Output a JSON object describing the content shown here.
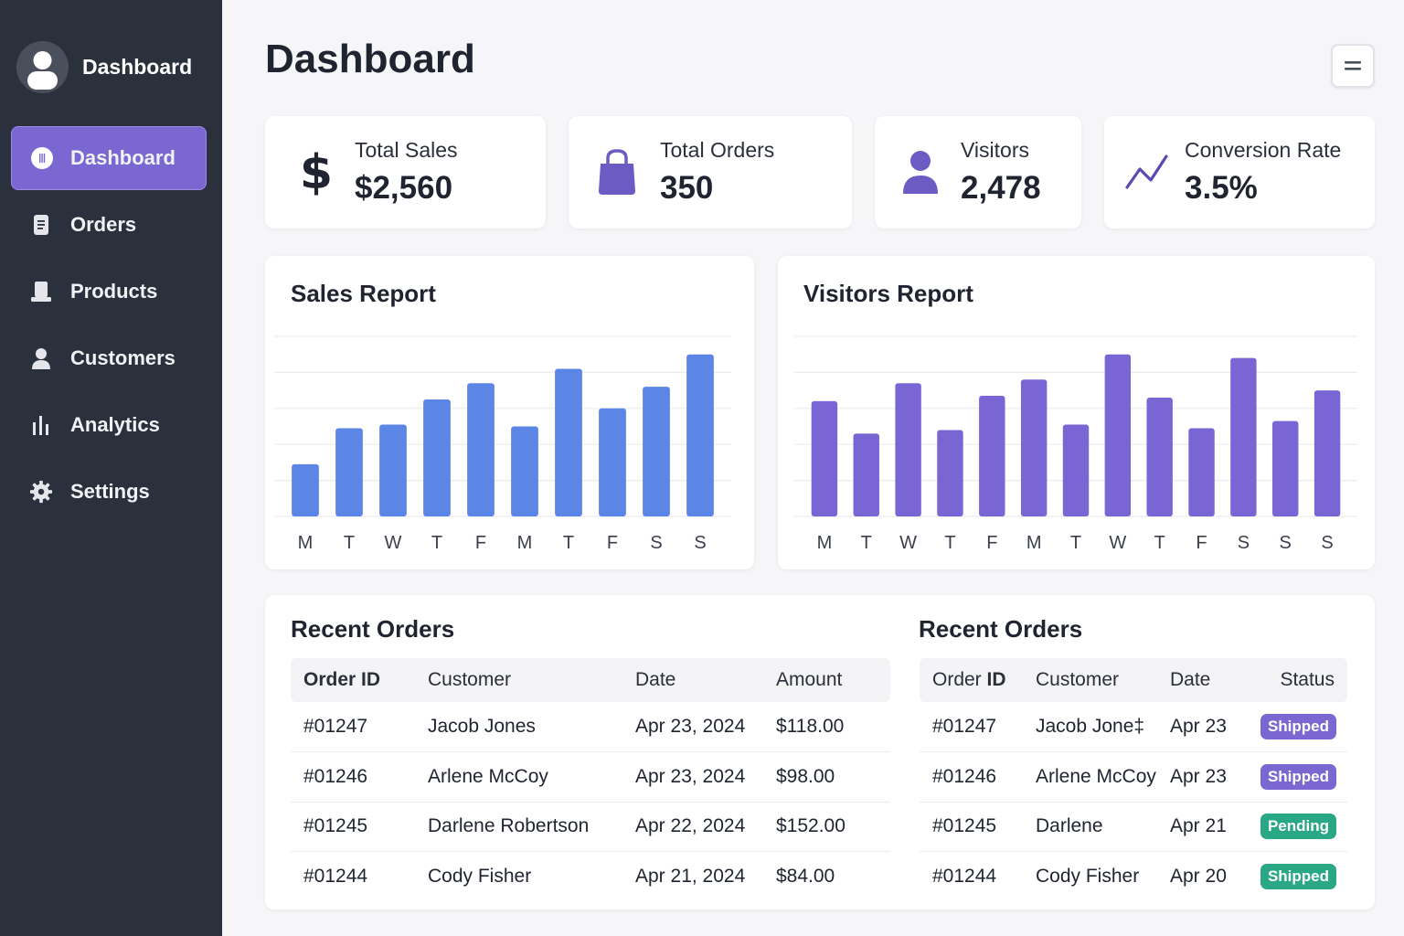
{
  "sidebar": {
    "brand": "Dashboard",
    "items": [
      {
        "label": "Dashboard",
        "icon": "dashboard-icon",
        "active": true
      },
      {
        "label": "Orders",
        "icon": "document-icon"
      },
      {
        "label": "Products",
        "icon": "box-icon"
      },
      {
        "label": "Customers",
        "icon": "user-icon"
      },
      {
        "label": "Analytics",
        "icon": "bar-chart-icon"
      },
      {
        "label": "Settings",
        "icon": "gear-icon"
      }
    ]
  },
  "header": {
    "title": "Dashboard",
    "menu_icon": "menu-icon"
  },
  "stats": [
    {
      "label": "Total Sales",
      "value": "$2,560",
      "icon": "dollar-icon"
    },
    {
      "label": "Total Orders",
      "value": "350",
      "icon": "shopping-bag-icon"
    },
    {
      "label": "Visitors",
      "value": "2,478",
      "icon": "user-icon"
    },
    {
      "label": "Conversion Rate",
      "value": "3.5%",
      "icon": "trend-line-icon"
    }
  ],
  "colors": {
    "sidebar_bg": "#2a313c",
    "accent": "#7a67d1",
    "sales_bar": "#5b86e5",
    "visitors_bar": "#7966d4",
    "shipped": "#7a67d1",
    "pending": "#2aa784"
  },
  "chart_data": [
    {
      "type": "bar",
      "title": "Sales Report",
      "categories": [
        "M",
        "T",
        "W",
        "T",
        "F",
        "M",
        "T",
        "F",
        "S",
        "S"
      ],
      "values": [
        29,
        49,
        51,
        65,
        74,
        50,
        82,
        60,
        72,
        90
      ],
      "ylim": [
        0,
        100
      ],
      "grid": true
    },
    {
      "type": "bar",
      "title": "Visitors Report",
      "categories": [
        "M",
        "T",
        "W",
        "T",
        "F",
        "M",
        "T",
        "W",
        "T",
        "F",
        "S",
        "S",
        "S"
      ],
      "values": [
        64,
        46,
        74,
        48,
        67,
        76,
        51,
        90,
        66,
        49,
        88,
        53,
        70
      ],
      "ylim": [
        0,
        100
      ],
      "grid": true
    }
  ],
  "orders_left": {
    "title": "Recent Orders",
    "columns": [
      "Order ID",
      "Customer",
      "Date",
      "Amount"
    ],
    "rows": [
      [
        "#01247",
        "Jacob Jones",
        "Apr 23, 2024",
        "$118.00"
      ],
      [
        "#01246",
        "Arlene McCoy",
        "Apr 23, 2024",
        "$98.00"
      ],
      [
        "#01245",
        "Darlene Robertson",
        "Apr 22, 2024",
        "$152.00"
      ],
      [
        "#01244",
        "Cody Fisher",
        "Apr 21, 2024",
        "$84.00"
      ]
    ]
  },
  "orders_right": {
    "title": "Recent Orders",
    "columns": [
      "Order ID",
      "Customer",
      "Date",
      "Status"
    ],
    "rows": [
      {
        "id": "#01247",
        "customer": "Jacob Jone‡",
        "date": "Apr 23",
        "status": "Shipped",
        "color": "#7a67d1"
      },
      {
        "id": "#01246",
        "customer": "Arlene McCoy",
        "date": "Apr 23",
        "status": "Shipped",
        "color": "#7a67d1"
      },
      {
        "id": "#01245",
        "customer": "Darlene",
        "date": "Apr 21",
        "status": "Pending",
        "color": "#2aa784"
      },
      {
        "id": "#01244",
        "customer": "Cody Fisher",
        "date": "Apr 20",
        "status": "Shipped",
        "color": "#2aa784"
      }
    ]
  }
}
